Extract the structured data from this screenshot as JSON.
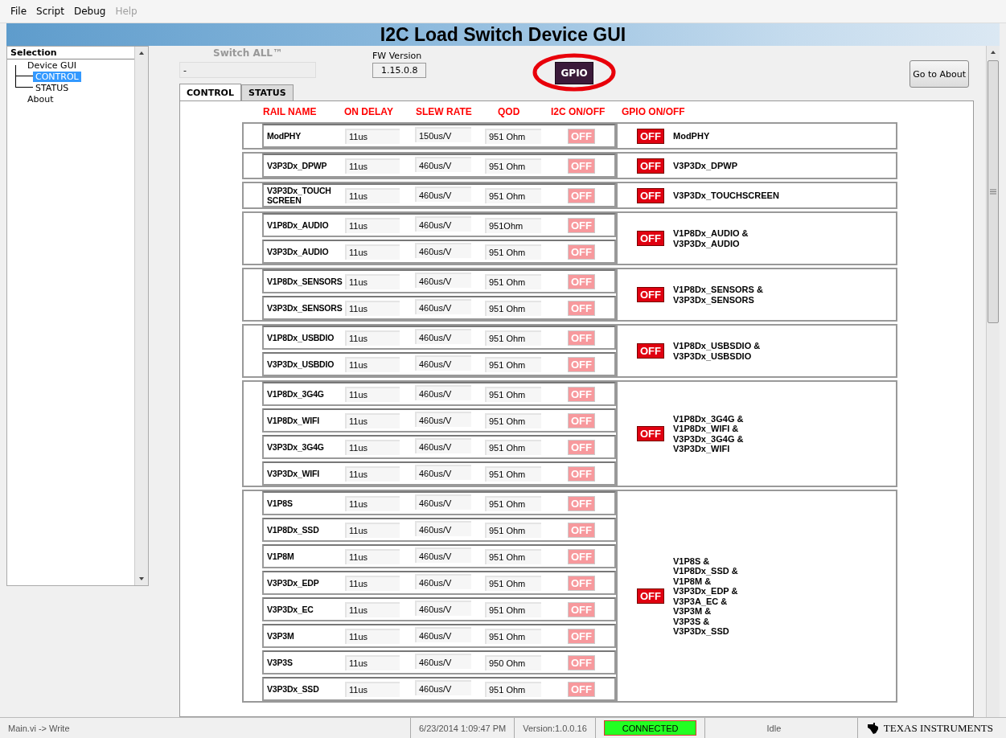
{
  "menu": [
    {
      "label": "File",
      "disabled": false
    },
    {
      "label": "Script",
      "disabled": false
    },
    {
      "label": "Debug",
      "disabled": false
    },
    {
      "label": "Help",
      "disabled": true
    }
  ],
  "window": {
    "title": "I2C Load Switch Device GUI"
  },
  "sidebar": {
    "header": "Selection",
    "items": [
      {
        "label": "Device GUI",
        "selected": false,
        "children": [
          {
            "label": "CONTROL",
            "selected": true
          },
          {
            "label": "STATUS",
            "selected": false
          }
        ]
      },
      {
        "label": "About",
        "selected": false
      }
    ]
  },
  "switch_all": {
    "label": "Switch ALL™",
    "disabled": true,
    "value": "-"
  },
  "fw_version": {
    "label": "FW Version",
    "value": "1.15.0.8"
  },
  "gpio_button": {
    "label": "GPIO",
    "highlighted": true
  },
  "about_button": {
    "label": "Go to About"
  },
  "tabs": [
    {
      "label": "CONTROL",
      "selected": true
    },
    {
      "label": "STATUS",
      "selected": false
    }
  ],
  "table": {
    "columns": [
      "RAIL NAME",
      "ON DELAY",
      "SLEW RATE",
      "QOD",
      "I2C ON/OFF",
      "GPIO ON/OFF"
    ],
    "groups": [
      {
        "gpio": {
          "label": "OFF",
          "on": false
        },
        "gpio_label": "ModPHY",
        "rails": [
          {
            "name": "ModPHY",
            "on_delay": "11us",
            "slew_rate": "150us/V",
            "qod": "951 Ohm",
            "i2c": {
              "label": "OFF",
              "on": false,
              "disabled": true
            }
          }
        ]
      },
      {
        "gpio": {
          "label": "OFF",
          "on": false
        },
        "gpio_label": "V3P3Dx_DPWP",
        "rails": [
          {
            "name": "V3P3Dx_DPWP",
            "on_delay": "11us",
            "slew_rate": "460us/V",
            "qod": "951 Ohm",
            "i2c": {
              "label": "OFF",
              "on": false,
              "disabled": true
            }
          }
        ]
      },
      {
        "gpio": {
          "label": "OFF",
          "on": false
        },
        "gpio_label": "V3P3Dx_TOUCHSCREEN",
        "rails": [
          {
            "name": "V3P3Dx_TOUCH SCREEN",
            "on_delay": "11us",
            "slew_rate": "460us/V",
            "qod": "951 Ohm",
            "i2c": {
              "label": "OFF",
              "on": false,
              "disabled": true
            }
          }
        ]
      },
      {
        "gpio": {
          "label": "OFF",
          "on": false
        },
        "gpio_label": "V1P8Dx_AUDIO &\nV3P3Dx_AUDIO",
        "rails": [
          {
            "name": "V1P8Dx_AUDIO",
            "on_delay": "11us",
            "slew_rate": "460us/V",
            "qod": "951Ohm",
            "i2c": {
              "label": "OFF",
              "on": false,
              "disabled": true
            }
          },
          {
            "name": "V3P3Dx_AUDIO",
            "on_delay": "11us",
            "slew_rate": "460us/V",
            "qod": "951 Ohm",
            "i2c": {
              "label": "OFF",
              "on": false,
              "disabled": true
            }
          }
        ]
      },
      {
        "gpio": {
          "label": "OFF",
          "on": false
        },
        "gpio_label": "V1P8Dx_SENSORS &\nV3P3Dx_SENSORS",
        "rails": [
          {
            "name": "V1P8Dx_SENSORS",
            "on_delay": "11us",
            "slew_rate": "460us/V",
            "qod": "951 Ohm",
            "i2c": {
              "label": "OFF",
              "on": false,
              "disabled": true
            }
          },
          {
            "name": "V3P3Dx_SENSORS",
            "on_delay": "11us",
            "slew_rate": "460us/V",
            "qod": "951 Ohm",
            "i2c": {
              "label": "OFF",
              "on": false,
              "disabled": true
            }
          }
        ]
      },
      {
        "gpio": {
          "label": "OFF",
          "on": false
        },
        "gpio_label": "V1P8Dx_USBSDIO &\nV3P3Dx_USBSDIO",
        "rails": [
          {
            "name": "V1P8Dx_USBDIO",
            "on_delay": "11us",
            "slew_rate": "460us/V",
            "qod": "951 Ohm",
            "i2c": {
              "label": "OFF",
              "on": false,
              "disabled": true
            }
          },
          {
            "name": "V3P3Dx_USBDIO",
            "on_delay": "11us",
            "slew_rate": "460us/V",
            "qod": "951 Ohm",
            "i2c": {
              "label": "OFF",
              "on": false,
              "disabled": true
            }
          }
        ]
      },
      {
        "gpio": {
          "label": "OFF",
          "on": false
        },
        "gpio_label": "V1P8Dx_3G4G &\nV1P8Dx_WIFI &\nV3P3Dx_3G4G &\nV3P3Dx_WIFI",
        "rails": [
          {
            "name": "V1P8Dx_3G4G",
            "on_delay": "11us",
            "slew_rate": "460us/V",
            "qod": "951 Ohm",
            "i2c": {
              "label": "OFF",
              "on": false,
              "disabled": true
            }
          },
          {
            "name": "V1P8Dx_WIFI",
            "on_delay": "11us",
            "slew_rate": "460us/V",
            "qod": "951 Ohm",
            "i2c": {
              "label": "OFF",
              "on": false,
              "disabled": true
            }
          },
          {
            "name": "V3P3Dx_3G4G",
            "on_delay": "11us",
            "slew_rate": "460us/V",
            "qod": "951 Ohm",
            "i2c": {
              "label": "OFF",
              "on": false,
              "disabled": true
            }
          },
          {
            "name": "V3P3Dx_WIFI",
            "on_delay": "11us",
            "slew_rate": "460us/V",
            "qod": "951 Ohm",
            "i2c": {
              "label": "OFF",
              "on": false,
              "disabled": true
            }
          }
        ]
      },
      {
        "gpio": {
          "label": "OFF",
          "on": false
        },
        "gpio_label": "V1P8S &\nV1P8Dx_SSD &\nV1P8M &\nV3P3Dx_EDP &\nV3P3A_EC &\nV3P3M &\nV3P3S &\nV3P3Dx_SSD",
        "rails": [
          {
            "name": "V1P8S",
            "on_delay": "11us",
            "slew_rate": "460us/V",
            "qod": "951 Ohm",
            "i2c": {
              "label": "OFF",
              "on": false,
              "disabled": true
            }
          },
          {
            "name": "V1P8Dx_SSD",
            "on_delay": "11us",
            "slew_rate": "460us/V",
            "qod": "951 Ohm",
            "i2c": {
              "label": "OFF",
              "on": false,
              "disabled": true
            }
          },
          {
            "name": "V1P8M",
            "on_delay": "11us",
            "slew_rate": "460us/V",
            "qod": "951 Ohm",
            "i2c": {
              "label": "OFF",
              "on": false,
              "disabled": true
            }
          },
          {
            "name": "V3P3Dx_EDP",
            "on_delay": "11us",
            "slew_rate": "460us/V",
            "qod": "951 Ohm",
            "i2c": {
              "label": "OFF",
              "on": false,
              "disabled": true
            }
          },
          {
            "name": "V3P3Dx_EC",
            "on_delay": "11us",
            "slew_rate": "460us/V",
            "qod": "951 Ohm",
            "i2c": {
              "label": "OFF",
              "on": false,
              "disabled": true
            }
          },
          {
            "name": "V3P3M",
            "on_delay": "11us",
            "slew_rate": "460us/V",
            "qod": "951 Ohm",
            "i2c": {
              "label": "OFF",
              "on": false,
              "disabled": true
            }
          },
          {
            "name": "V3P3S",
            "on_delay": "11us",
            "slew_rate": "460us/V",
            "qod": "950 Ohm",
            "i2c": {
              "label": "OFF",
              "on": false,
              "disabled": true
            }
          },
          {
            "name": "V3P3Dx_SSD",
            "on_delay": "11us",
            "slew_rate": "460us/V",
            "qod": "951 Ohm",
            "i2c": {
              "label": "OFF",
              "on": false,
              "disabled": true
            }
          }
        ]
      }
    ]
  },
  "status_bar": {
    "path": "Main.vi -> Write",
    "datetime": "6/23/2014 1:09:47 PM",
    "version": "Version:1.0.0.16",
    "connection": {
      "label": "CONNECTED",
      "on": true
    },
    "state": "Idle",
    "logo": "TEXAS INSTRUMENTS"
  }
}
